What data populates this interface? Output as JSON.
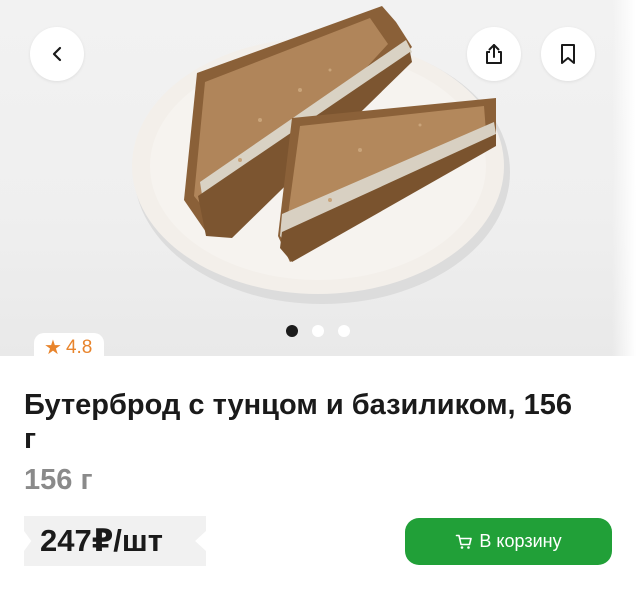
{
  "product": {
    "title": "Бутерброд с тунцом и базиликом, 156 г",
    "weight": "156 г",
    "rating": "4.8",
    "price": "247₽/шт"
  },
  "gallery": {
    "total": 3,
    "active_index": 0
  },
  "actions": {
    "add_to_cart_label": "В корзину"
  },
  "icons": {
    "back": "chevron-left-icon",
    "share": "share-icon",
    "bookmark": "bookmark-icon",
    "star": "star-icon",
    "cart": "cart-icon"
  },
  "colors": {
    "accent_green": "#21a038",
    "rating_orange": "#e8842c",
    "hero_background": "#f0f0f0"
  }
}
